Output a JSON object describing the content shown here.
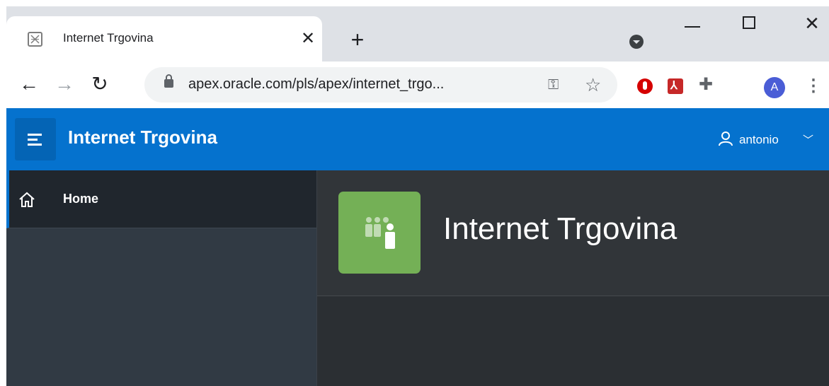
{
  "browser": {
    "tab": {
      "title": "Internet Trgovina",
      "favicon": "apex-icon"
    },
    "url": "apex.oracle.com/pls/apex/internet_trgo...",
    "extensions": [
      "ublock-icon",
      "pdf-icon",
      "puzzle-icon"
    ],
    "profile_initial": "A"
  },
  "app": {
    "title": "Internet Trgovina",
    "user": {
      "name": "antonio"
    },
    "nav": [
      {
        "label": "Home",
        "icon": "home-icon",
        "active": true
      }
    ],
    "hero": {
      "title": "Internet Trgovina",
      "icon": "users-icon"
    }
  },
  "colors": {
    "header": "#0572ce",
    "sidebar": "#313a44",
    "sidebar_active": "#20262d",
    "hero_icon": "#74b056",
    "main_bg": "#2b2f33"
  }
}
